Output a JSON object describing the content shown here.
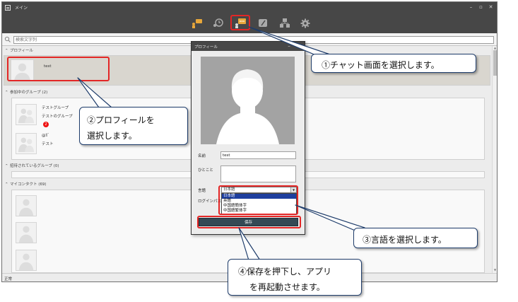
{
  "window": {
    "title": "メイン",
    "controls": [
      "–",
      "▫",
      "✕"
    ]
  },
  "toolbar": {
    "icons": [
      "news-icon",
      "history-icon",
      "chat-icon",
      "note-icon",
      "org-icon",
      "settings-icon"
    ],
    "accent_color": "#e8a73a"
  },
  "search": {
    "placeholder": "検索文字列"
  },
  "sections": {
    "profile": {
      "label": "プロフィール",
      "user_name": "test"
    },
    "groups": {
      "label": "参加中のグループ (2)",
      "items": [
        {
          "name": "テストグループ"
        },
        {
          "name": "テストのグループ",
          "badge": "2"
        },
        {
          "name": "@ｶﾞ"
        },
        {
          "name": "テスト"
        }
      ]
    },
    "invited": {
      "label": "招待されているグループ (0)"
    },
    "contacts": {
      "label": "マイコンタクト (69)"
    }
  },
  "status": {
    "text": "正常"
  },
  "dialog": {
    "title": "プロフィール",
    "name_label": "名前",
    "name_value": "test",
    "comment_label": "ひとこと",
    "language_label": "言語",
    "login_pass_label": "ログインパス",
    "selected_language": "日本語",
    "language_options": [
      "日本語",
      "英語",
      "中国語簡体字",
      "中国語繁体字"
    ],
    "save_label": "保存"
  },
  "callouts": {
    "step1": "①チャット画面を選択します。",
    "step2_line1": "②プロフィールを",
    "step2_line2": "選択します。",
    "step3": "③言語を選択します。",
    "step4_line1": "④保存を押下し、アプリ",
    "step4_line2": "を再起動させます。"
  },
  "colors": {
    "highlight": "#e32626",
    "callout_border": "#1f3d6b",
    "dark_bar": "#474747",
    "save_button": "#344955"
  }
}
